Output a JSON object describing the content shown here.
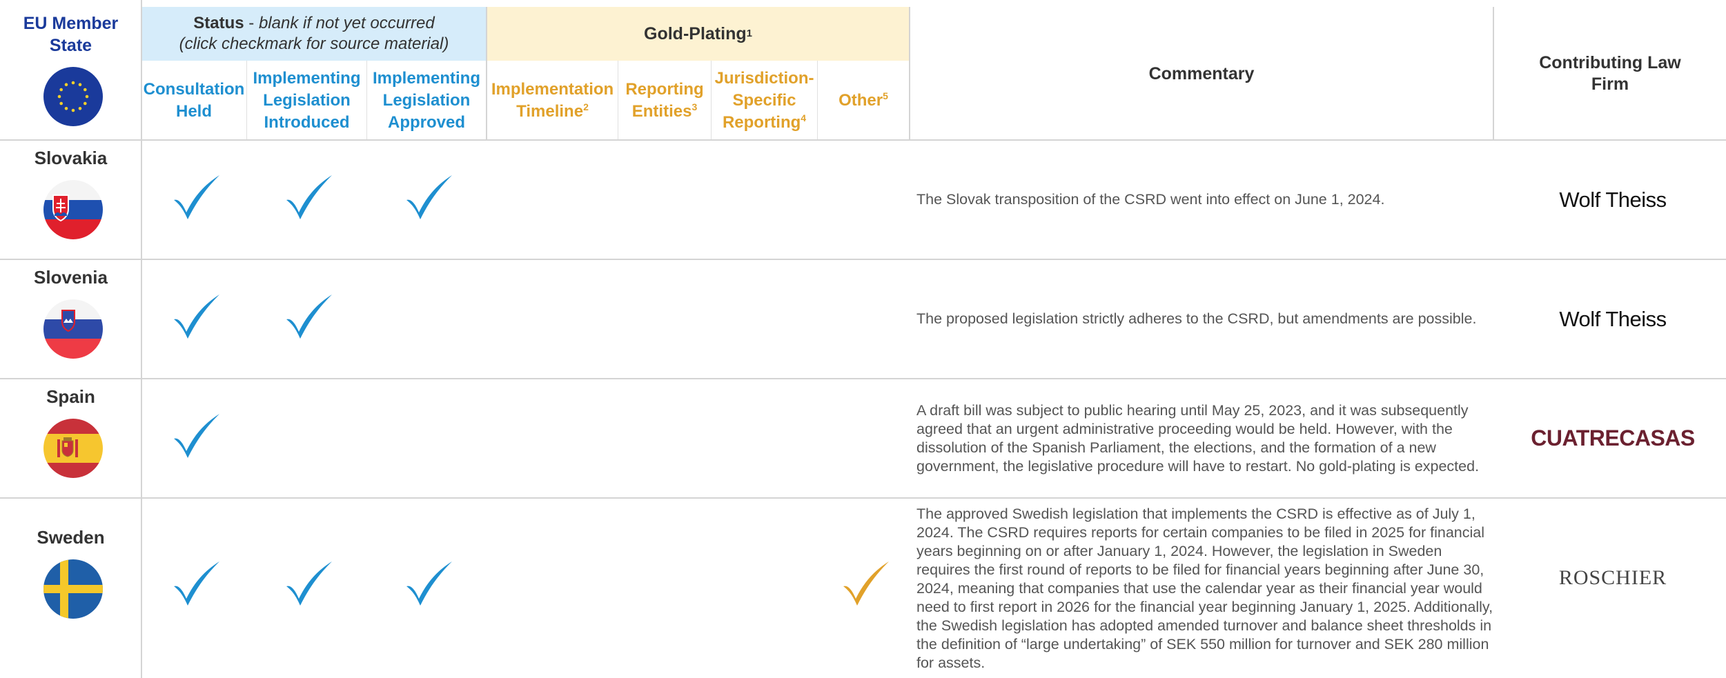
{
  "header": {
    "member_state": "EU Member State",
    "status_title": "Status",
    "status_sep": " - ",
    "status_note1": "blank if not yet occurred",
    "status_note2": "(click checkmark for source material)",
    "gold_plating": "Gold-Plating",
    "gold_plating_sup": "1",
    "commentary": "Commentary",
    "contributing_firm": "Contributing Law Firm",
    "columns": [
      {
        "label": "Consultation Held",
        "sup": "",
        "group": "status"
      },
      {
        "label": "Implementing Legislation Introduced",
        "sup": "",
        "group": "status"
      },
      {
        "label": "Implementing Legislation Approved",
        "sup": "",
        "group": "status"
      },
      {
        "label": "Implementation Timeline",
        "sup": "2",
        "group": "gold"
      },
      {
        "label": "Reporting Entities",
        "sup": "3",
        "group": "gold"
      },
      {
        "label": "Jurisdiction-Specific Reporting",
        "sup": "4",
        "group": "gold"
      },
      {
        "label": "Other",
        "sup": "5",
        "group": "gold"
      }
    ]
  },
  "colors": {
    "status_blue": "#1e8fd0",
    "gold": "#e1a12a",
    "eu_blue": "#1a3a9b",
    "status_band": "#d6ecfa",
    "gold_band": "#fdf2d2"
  },
  "rows": [
    {
      "country": "Slovakia",
      "flag": "slovakia-flag-icon",
      "checks": [
        "consultation_held",
        "legislation_introduced",
        "legislation_approved"
      ],
      "commentary": "The Slovak transposition of the CSRD went into effect on June 1, 2024.",
      "firm": "Wolf Theiss"
    },
    {
      "country": "Slovenia",
      "flag": "slovenia-flag-icon",
      "checks": [
        "consultation_held",
        "legislation_introduced"
      ],
      "commentary": "The proposed legislation strictly adheres to the CSRD, but amendments are possible.",
      "firm": "Wolf Theiss"
    },
    {
      "country": "Spain",
      "flag": "spain-flag-icon",
      "checks": [
        "consultation_held"
      ],
      "commentary": "A draft bill was subject to public hearing until May 25, 2023, and it was subsequently agreed that an urgent administrative proceeding would be held. However, with the dissolution of the Spanish Parliament, the elections, and the formation of a new government, the legislative procedure will have to restart. No gold-plating is expected.",
      "firm": "CUATRECASAS"
    },
    {
      "country": "Sweden",
      "flag": "sweden-flag-icon",
      "checks": [
        "consultation_held",
        "legislation_introduced",
        "legislation_approved",
        "other"
      ],
      "commentary": "The approved Swedish legislation that implements the CSRD is effective as of July 1, 2024. The CSRD requires reports for certain companies to be filed in 2025 for financial years beginning on or after January 1, 2024. However, the legislation in Sweden requires the first round of reports to be filed for financial years beginning after June 30, 2024, meaning that companies that use the calendar year as their financial year would need to first report in 2026 for the financial year beginning January 1, 2025. Additionally, the Swedish legislation has adopted amended turnover and balance sheet thresholds in the definition of “large undertaking” of SEK 550 million for turnover and SEK 280 million for assets.",
      "firm": "ROSCHIER"
    }
  ]
}
